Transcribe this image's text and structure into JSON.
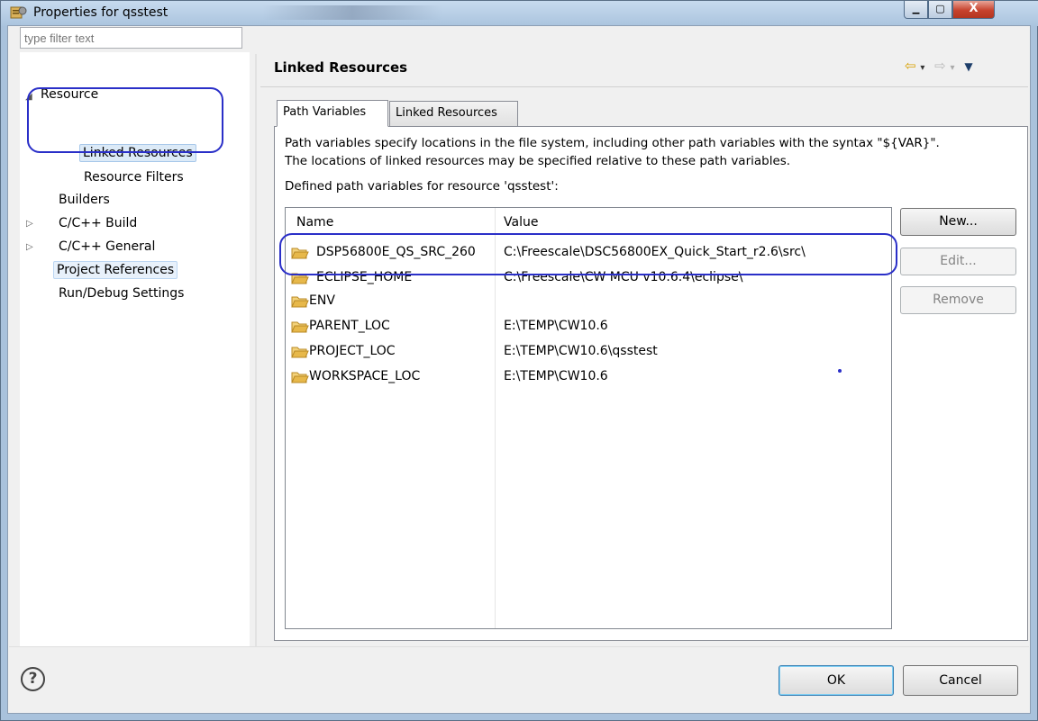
{
  "window": {
    "title": "Properties for qsstest",
    "close_glyph": "X",
    "minimize_glyph": "▁",
    "maximize_glyph": "▢"
  },
  "sidebar": {
    "filter_placeholder": "type filter text",
    "items": [
      {
        "label": "Resource",
        "twisty": "◢"
      },
      {
        "label": "Linked Resources",
        "state": "selected"
      },
      {
        "label": "Resource Filters"
      },
      {
        "label": "Builders"
      },
      {
        "label": "C/C++ Build",
        "twisty": "▷"
      },
      {
        "label": "C/C++ General",
        "twisty": "▷"
      },
      {
        "label": "Project References",
        "state": "hover"
      },
      {
        "label": "Run/Debug Settings"
      }
    ]
  },
  "panel": {
    "title": "Linked Resources",
    "nav": {
      "back": "⇦",
      "forward": "⇨",
      "dropdown": "▾",
      "menu": "▼"
    },
    "tabs": [
      {
        "label": "Path Variables",
        "active": true
      },
      {
        "label": "Linked Resources",
        "active": false
      }
    ],
    "description_line1": "Path variables specify locations in the file system, including other path variables with the syntax \"${VAR}\".",
    "description_line2": "The locations of linked resources may be specified relative to these path variables.",
    "defined_label": "Defined path variables for resource 'qsstest':",
    "table": {
      "columns": [
        "Name",
        "Value"
      ],
      "rows": [
        {
          "name": "DSP56800E_QS_SRC_260",
          "value": "C:\\Freescale\\DSC56800EX_Quick_Start_r2.6\\src\\"
        },
        {
          "name": "ECLIPSE_HOME",
          "value": "C:\\Freescale\\CW MCU v10.6.4\\eclipse\\"
        },
        {
          "name": "ENV",
          "value": ""
        },
        {
          "name": "PARENT_LOC",
          "value": "E:\\TEMP\\CW10.6"
        },
        {
          "name": "PROJECT_LOC",
          "value": "E:\\TEMP\\CW10.6\\qsstest"
        },
        {
          "name": "WORKSPACE_LOC",
          "value": "E:\\TEMP\\CW10.6"
        }
      ]
    },
    "buttons": {
      "new": "New...",
      "edit": "Edit...",
      "remove": "Remove"
    }
  },
  "footer": {
    "help": "?",
    "ok": "OK",
    "cancel": "Cancel"
  },
  "colors": {
    "annotation": "#2a2fc8",
    "folder": "#e7b84a"
  }
}
